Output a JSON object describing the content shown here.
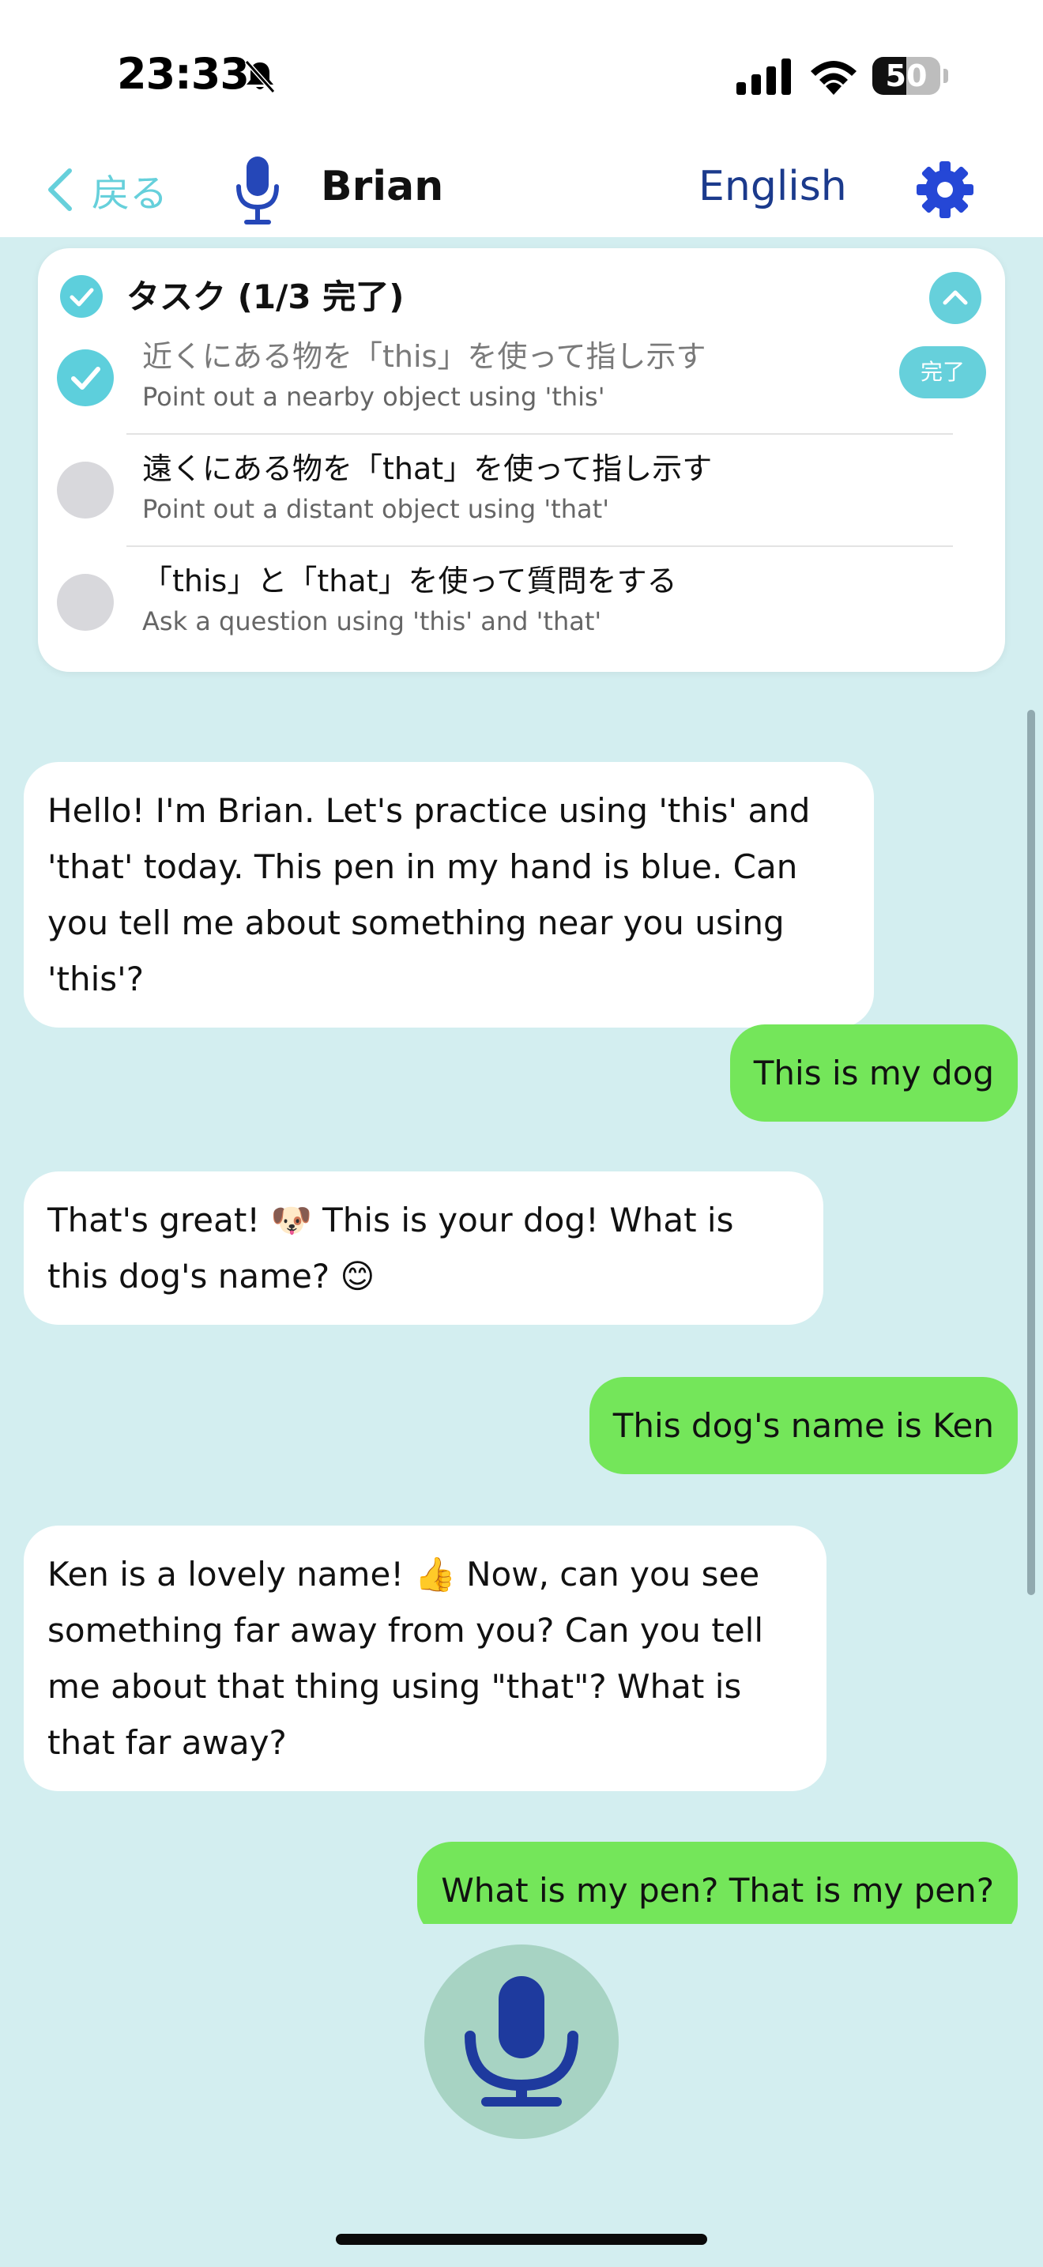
{
  "status_bar": {
    "time": "23:33",
    "battery_text": "50",
    "battery_level_percent": 50
  },
  "nav": {
    "back_label": "戻る",
    "tutor_name": "Brian",
    "language": "English"
  },
  "tasks": {
    "header": "タスク (1/3 完了)",
    "done_badge": "完了",
    "items": [
      {
        "title": "近くにある物を「this」を使って指し示す",
        "subtitle": "Point out a nearby object using 'this'",
        "done": true
      },
      {
        "title": "遠くにある物を「that」を使って指し示す",
        "subtitle": "Point out a distant object using 'that'",
        "done": false
      },
      {
        "title": "「this」と「that」を使って質問をする",
        "subtitle": "Ask a question using 'this' and 'that'",
        "done": false
      }
    ]
  },
  "messages": [
    {
      "role": "bot",
      "text": "Hello! I'm Brian. Let's practice using 'this' and 'that' today. This pen in my hand is blue. Can you tell me about something near you using 'this'?"
    },
    {
      "role": "user",
      "text": "This is my dog"
    },
    {
      "role": "bot",
      "text": "That's great! 🐶 This is your dog! What is this dog's name? 😊"
    },
    {
      "role": "user",
      "text": "This dog's name is Ken"
    },
    {
      "role": "bot",
      "text": "Ken is a lovely name! 👍 Now, can you see something far away from you? Can you tell me about that thing using \"that\"? What is that far away?"
    },
    {
      "role": "user",
      "text": "What is my pen? That is my pen?"
    }
  ],
  "colors": {
    "accent": "#66d0db",
    "navy": "#1b3a8c",
    "user_bubble": "#74e65a",
    "background": "#d3eef0",
    "mic_bg": "#a7d3c3"
  },
  "icons": {
    "back": "chevron-left-icon",
    "mic": "microphone-icon",
    "settings": "gear-icon",
    "collapse": "chevron-up-icon",
    "check": "checkmark-icon"
  }
}
